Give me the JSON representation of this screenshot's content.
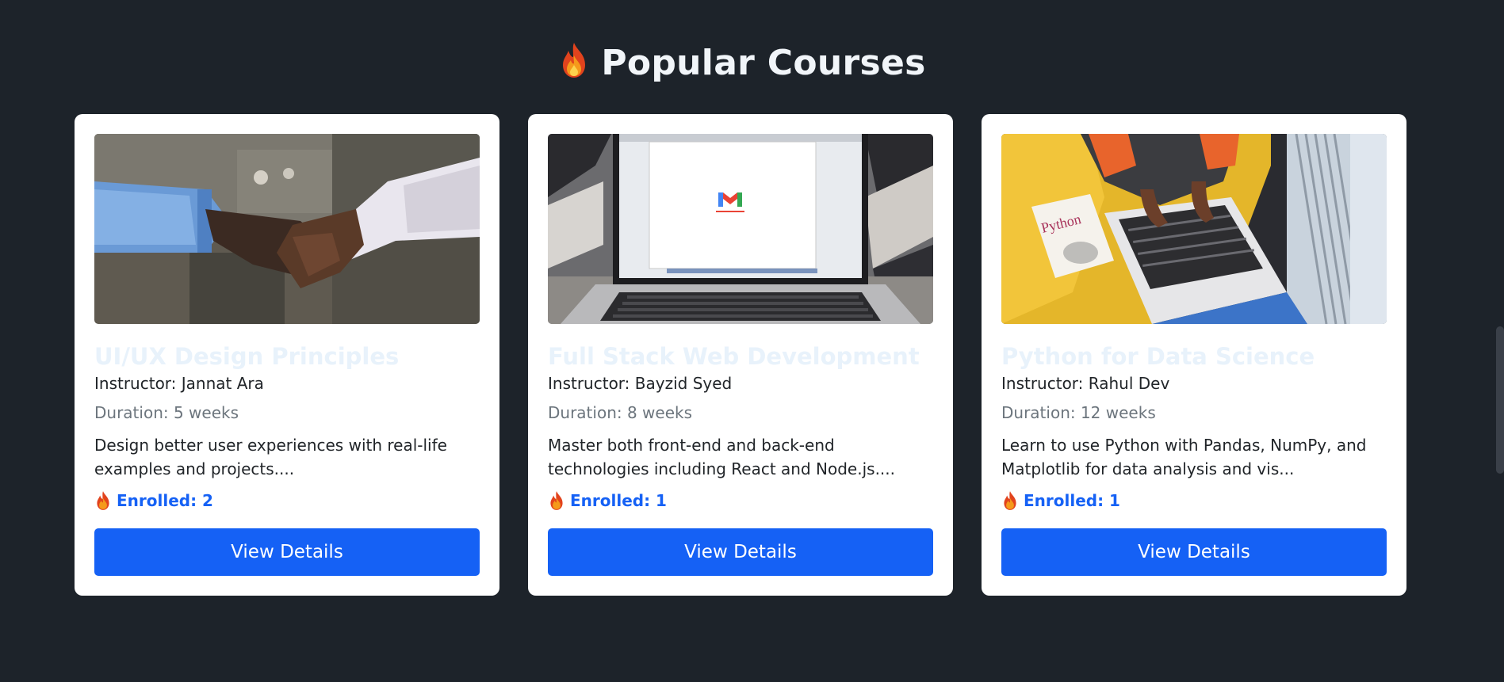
{
  "section": {
    "title": "Popular Courses"
  },
  "courses": [
    {
      "title": "UI/UX Design Principles",
      "instructor": "Instructor: Jannat Ara",
      "duration": "Duration: 5 weeks",
      "description": "Design better user experiences with real-life examples and projects....",
      "enrolled": "Enrolled: 2",
      "button": "View Details",
      "image": "handshake-photo"
    },
    {
      "title": "Full Stack Web Development",
      "instructor": "Instructor: Bayzid Syed",
      "duration": "Duration: 8 weeks",
      "description": "Master both front-end and back-end technologies including React and Node.js....",
      "enrolled": "Enrolled: 1",
      "button": "View Details",
      "image": "laptop-gmail-photo"
    },
    {
      "title": "Python for Data Science",
      "instructor": "Instructor: Rahul Dev",
      "duration": "Duration: 12 weeks",
      "description": "Learn to use Python with Pandas, NumPy, and Matplotlib for data analysis and vis...",
      "enrolled": "Enrolled: 1",
      "button": "View Details",
      "image": "python-laptop-photo"
    }
  ],
  "colors": {
    "background": "#1d232a",
    "accent": "#1561f5",
    "card": "#ffffff"
  }
}
